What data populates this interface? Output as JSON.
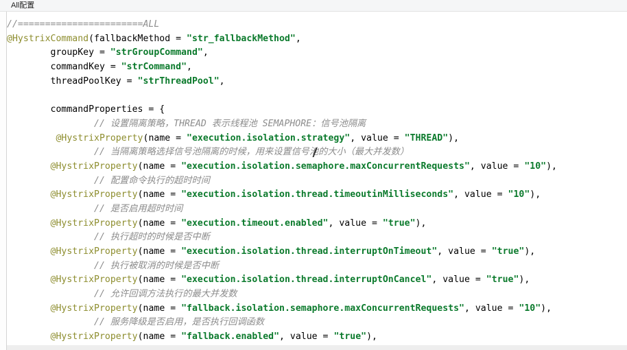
{
  "window": {
    "title": "All配置"
  },
  "code": {
    "lines": [
      [
        {
          "t": "c",
          "v": "//=======================ALL"
        }
      ],
      [
        {
          "t": "a",
          "v": "@HystrixCommand"
        },
        {
          "t": "p",
          "v": "(fallbackMethod = "
        },
        {
          "t": "s",
          "v": "\"str_fallbackMethod\""
        },
        {
          "t": "p",
          "v": ","
        }
      ],
      [
        {
          "t": "p",
          "v": "        groupKey = "
        },
        {
          "t": "s",
          "v": "\"strGroupCommand\""
        },
        {
          "t": "p",
          "v": ","
        }
      ],
      [
        {
          "t": "p",
          "v": "        commandKey = "
        },
        {
          "t": "s",
          "v": "\"strCommand\""
        },
        {
          "t": "p",
          "v": ","
        }
      ],
      [
        {
          "t": "p",
          "v": "        threadPoolKey = "
        },
        {
          "t": "s",
          "v": "\"strThreadPool\""
        },
        {
          "t": "p",
          "v": ","
        }
      ],
      [
        {
          "t": "p",
          "v": ""
        }
      ],
      [
        {
          "t": "p",
          "v": "        commandProperties = {"
        }
      ],
      [
        {
          "t": "c",
          "v": "                // 设置隔离策略，THREAD 表示线程池 SEMAPHORE：信号池隔离"
        }
      ],
      [
        {
          "t": "p",
          "v": "         "
        },
        {
          "t": "a",
          "v": "@HystrixProperty"
        },
        {
          "t": "p",
          "v": "(name = "
        },
        {
          "t": "s",
          "v": "\"execution.isolation.strategy\""
        },
        {
          "t": "p",
          "v": ", value = "
        },
        {
          "t": "s",
          "v": "\"THREAD\""
        },
        {
          "t": "p",
          "v": "),"
        }
      ],
      [
        {
          "t": "c",
          "v": "                // 当隔离策略选择信号池隔离的时候，用来设置信号池的大小（最大并发数）"
        }
      ],
      [
        {
          "t": "p",
          "v": "        "
        },
        {
          "t": "a",
          "v": "@HystrixProperty"
        },
        {
          "t": "p",
          "v": "(name = "
        },
        {
          "t": "s",
          "v": "\"execution.isolation.semaphore.maxConcurrentRequests\""
        },
        {
          "t": "p",
          "v": ", value = "
        },
        {
          "t": "s",
          "v": "\"10\""
        },
        {
          "t": "p",
          "v": "),"
        }
      ],
      [
        {
          "t": "c",
          "v": "                // 配置命令执行的超时时间"
        }
      ],
      [
        {
          "t": "p",
          "v": "        "
        },
        {
          "t": "a",
          "v": "@HystrixProperty"
        },
        {
          "t": "p",
          "v": "(name = "
        },
        {
          "t": "s",
          "v": "\"execution.isolation.thread.timeoutinMilliseconds\""
        },
        {
          "t": "p",
          "v": ", value = "
        },
        {
          "t": "s",
          "v": "\"10\""
        },
        {
          "t": "p",
          "v": "),"
        }
      ],
      [
        {
          "t": "c",
          "v": "                // 是否启用超时时间"
        }
      ],
      [
        {
          "t": "p",
          "v": "        "
        },
        {
          "t": "a",
          "v": "@HystrixProperty"
        },
        {
          "t": "p",
          "v": "(name = "
        },
        {
          "t": "s",
          "v": "\"execution.timeout.enabled\""
        },
        {
          "t": "p",
          "v": ", value = "
        },
        {
          "t": "s",
          "v": "\"true\""
        },
        {
          "t": "p",
          "v": "),"
        }
      ],
      [
        {
          "t": "c",
          "v": "                // 执行超时的时候是否中断"
        }
      ],
      [
        {
          "t": "p",
          "v": "        "
        },
        {
          "t": "a",
          "v": "@HystrixProperty"
        },
        {
          "t": "p",
          "v": "(name = "
        },
        {
          "t": "s",
          "v": "\"execution.isolation.thread.interruptOnTimeout\""
        },
        {
          "t": "p",
          "v": ", value = "
        },
        {
          "t": "s",
          "v": "\"true\""
        },
        {
          "t": "p",
          "v": "),"
        }
      ],
      [
        {
          "t": "c",
          "v": "                // 执行被取消的时候是否中断"
        }
      ],
      [
        {
          "t": "p",
          "v": "        "
        },
        {
          "t": "a",
          "v": "@HystrixProperty"
        },
        {
          "t": "p",
          "v": "(name = "
        },
        {
          "t": "s",
          "v": "\"execution.isolation.thread.interruptOnCancel\""
        },
        {
          "t": "p",
          "v": ", value = "
        },
        {
          "t": "s",
          "v": "\"true\""
        },
        {
          "t": "p",
          "v": "),"
        }
      ],
      [
        {
          "t": "c",
          "v": "                // 允许回调方法执行的最大并发数"
        }
      ],
      [
        {
          "t": "p",
          "v": "        "
        },
        {
          "t": "a",
          "v": "@HystrixProperty"
        },
        {
          "t": "p",
          "v": "(name = "
        },
        {
          "t": "s",
          "v": "\"fallback.isolation.semaphore.maxConcurrentRequests\""
        },
        {
          "t": "p",
          "v": ", value = "
        },
        {
          "t": "s",
          "v": "\"10\""
        },
        {
          "t": "p",
          "v": "),"
        }
      ],
      [
        {
          "t": "c",
          "v": "                // 服务降级是否启用，是否执行回调函数"
        }
      ],
      [
        {
          "t": "p",
          "v": "        "
        },
        {
          "t": "a",
          "v": "@HystrixProperty"
        },
        {
          "t": "p",
          "v": "(name = "
        },
        {
          "t": "s",
          "v": "\"fallback.enabled\""
        },
        {
          "t": "p",
          "v": ", value = "
        },
        {
          "t": "s",
          "v": "\"true\""
        },
        {
          "t": "p",
          "v": "),"
        }
      ]
    ]
  }
}
